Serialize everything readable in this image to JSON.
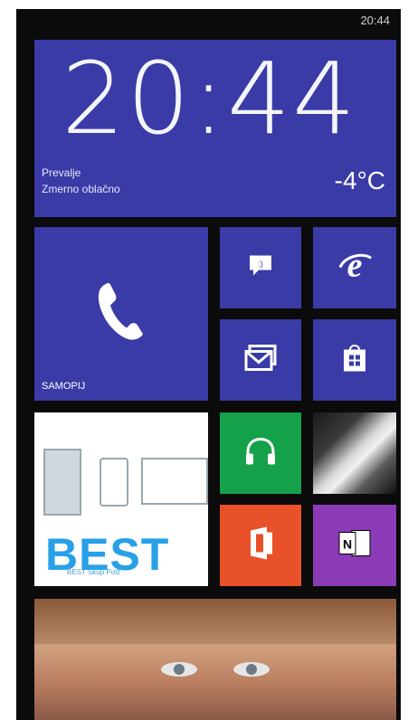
{
  "status": {
    "time": "20:44"
  },
  "clock_tile": {
    "time": "20:44",
    "city": "Prevalje",
    "condition": "Zmerno oblačno",
    "temperature": "-4°C"
  },
  "phone_tile": {
    "label": "SAMOPIJ"
  },
  "colors": {
    "tile_blue": "#3a3ba6",
    "tile_green": "#15a04a",
    "tile_orange": "#e8512a",
    "tile_purple": "#8a3bb5",
    "background": "#0b0b0b"
  },
  "best_tile": {
    "text": "BEST",
    "subtext": "BEST Skup Polž"
  },
  "icons": [
    "phone-icon",
    "messaging-icon",
    "internet-explorer-icon",
    "mail-icon",
    "store-icon",
    "music-headphones-icon",
    "office-icon",
    "onenote-icon"
  ]
}
